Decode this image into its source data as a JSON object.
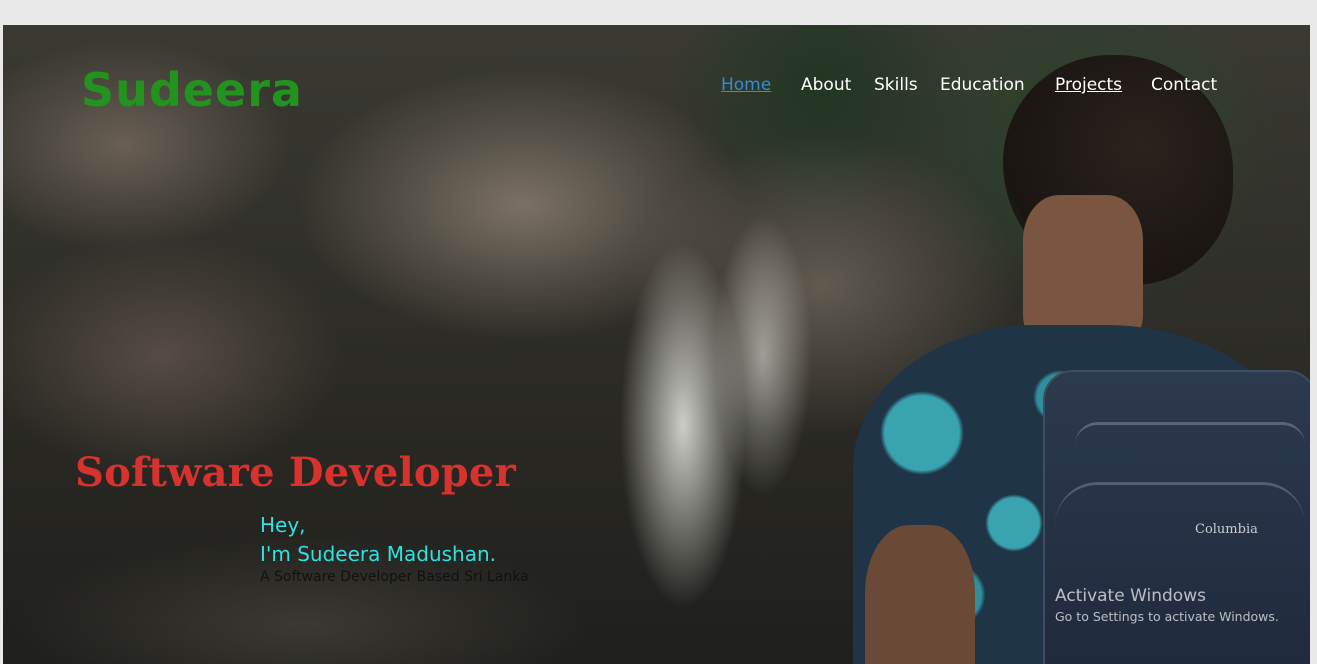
{
  "brand": {
    "name": "Sudeera",
    "color": "#22931e"
  },
  "nav": {
    "items": [
      {
        "label": "Home"
      },
      {
        "label": "About"
      },
      {
        "label": "Skills"
      },
      {
        "label": "Education"
      },
      {
        "label": "Projects"
      },
      {
        "label": "Contact"
      }
    ],
    "active_color": "#2f8fd8"
  },
  "hero": {
    "headline": "Software Developer",
    "headline_color": "#d8322f",
    "greeting": "Hey,",
    "intro": "I'm Sudeera Madushan.",
    "intro_color": "#31e0e0",
    "tagline": "A Software Developer Based Sri Lanka",
    "backpack_brand": "Columbia"
  },
  "watermark": {
    "title": "Activate Windows",
    "subtitle": "Go to Settings to activate Windows."
  }
}
